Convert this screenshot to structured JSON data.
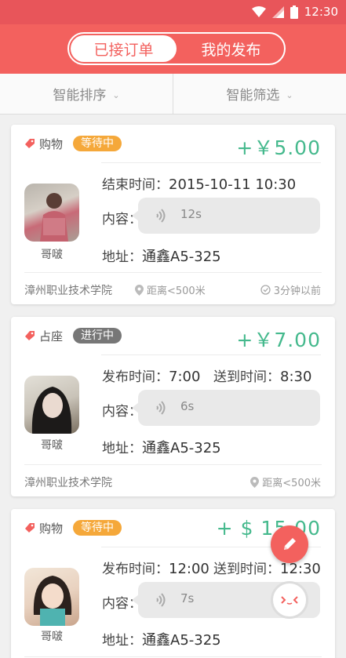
{
  "status": {
    "time": "12:30"
  },
  "header": {
    "tabs": [
      {
        "label": "已接订单",
        "active": true
      },
      {
        "label": "我的发布",
        "active": false
      }
    ]
  },
  "filters": [
    {
      "label": "智能排序"
    },
    {
      "label": "智能筛选"
    }
  ],
  "colors": {
    "brand": "#f3615e",
    "price": "#45b98d",
    "waiting": "#f5a83a",
    "in_progress": "#777777"
  },
  "cards": [
    {
      "category": "购物",
      "status": "等待中",
      "price": "+￥5.00",
      "row1_label": "结束时间：",
      "row1_value": "2015-10-11  10:30",
      "content_label": "内容：",
      "voice_duration": "12s",
      "address_label": "地址：",
      "address": "通鑫A5-325",
      "username": "哥啵",
      "school": "漳州职业技术学院",
      "distance": "距离<500米",
      "time_ago": "3分钟以前"
    },
    {
      "category": "占座",
      "status": "进行中",
      "price": "+￥7.00",
      "row1_label": "发布时间：",
      "row1_value": "7:00",
      "row1b_label": "送到时间：",
      "row1b_value": "8:30",
      "content_label": "内容：",
      "voice_duration": "6s",
      "address_label": "地址：",
      "address": "通鑫A5-325",
      "username": "哥啵",
      "school": "漳州职业技术学院",
      "distance": "距离<500米"
    },
    {
      "category": "购物",
      "status": "等待中",
      "price": "+ $ 15.00",
      "row1_label": "发布时间：",
      "row1_value": "12:00",
      "row1b_label": "送到时间：",
      "row1b_value": "12:30",
      "content_label": "内容：",
      "voice_duration": "7s",
      "address_label": "地址：",
      "address": "通鑫A5-325",
      "username": "哥啵"
    }
  ],
  "icons": {
    "fab": "pencil-icon",
    "float": "face-icon"
  }
}
